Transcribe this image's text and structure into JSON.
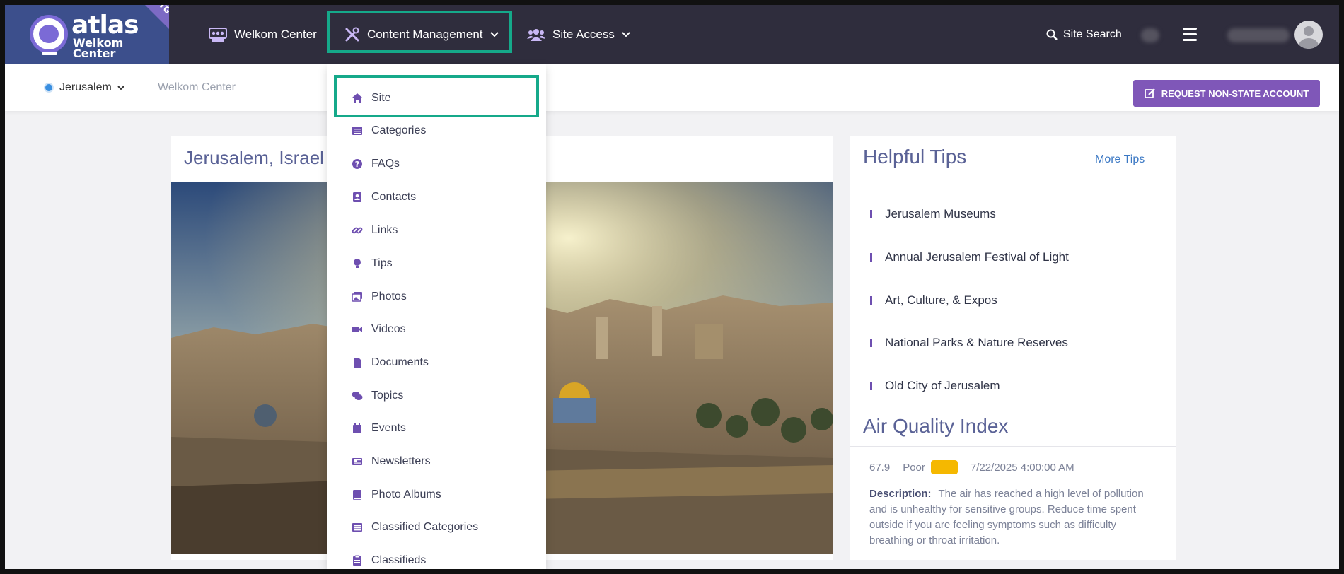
{
  "brand": {
    "logo_text": "atlas",
    "logo_sub_line1": "Welkom",
    "logo_sub_line2": "Center",
    "env_ribbon": "STG"
  },
  "nav": {
    "welkom_center": "Welkom Center",
    "content_management": "Content Management",
    "site_access": "Site Access",
    "site_search": "Site Search"
  },
  "dropdown": {
    "items": [
      {
        "label": "Site",
        "icon": "home-icon"
      },
      {
        "label": "Categories",
        "icon": "list-icon"
      },
      {
        "label": "FAQs",
        "icon": "question-icon"
      },
      {
        "label": "Contacts",
        "icon": "contact-icon"
      },
      {
        "label": "Links",
        "icon": "link-icon"
      },
      {
        "label": "Tips",
        "icon": "lightbulb-icon"
      },
      {
        "label": "Photos",
        "icon": "photos-icon"
      },
      {
        "label": "Videos",
        "icon": "video-icon"
      },
      {
        "label": "Documents",
        "icon": "document-icon"
      },
      {
        "label": "Topics",
        "icon": "comments-icon"
      },
      {
        "label": "Events",
        "icon": "calendar-icon"
      },
      {
        "label": "Newsletters",
        "icon": "newspaper-icon"
      },
      {
        "label": "Photo Albums",
        "icon": "album-icon"
      },
      {
        "label": "Classified Categories",
        "icon": "list-icon"
      },
      {
        "label": "Classifieds",
        "icon": "clipboard-icon"
      }
    ]
  },
  "subbar": {
    "city": "Jerusalem",
    "breadcrumb": "Welkom Center",
    "request_button": "REQUEST NON-STATE ACCOUNT"
  },
  "main": {
    "title": "Jerusalem, Israel"
  },
  "tips": {
    "title": "Helpful Tips",
    "more_link": "More Tips",
    "items": [
      "Jerusalem Museums",
      "Annual Jerusalem Festival of Light",
      "Art, Culture, & Expos",
      "National Parks & Nature Reserves",
      "Old City of Jerusalem"
    ]
  },
  "aqi": {
    "title": "Air Quality Index",
    "value": "67.9",
    "status": "Poor",
    "status_color": "#f5b800",
    "timestamp": "7/22/2025 4:00:00 AM",
    "description_label": "Description:",
    "description": "The air has reached a high level of pollution and is unhealthy for sensitive groups. Reduce time spent outside if you are feeling symptoms such as difficulty breathing or throat irritation."
  },
  "colors": {
    "nav_bg": "#2f2d3d",
    "accent_purple": "#7f57b8",
    "highlight_green": "#15a98a",
    "heading_blue": "#5a6296"
  }
}
